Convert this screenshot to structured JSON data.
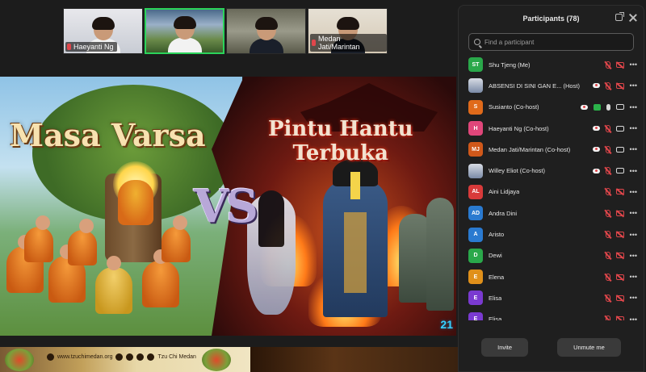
{
  "gallery": [
    {
      "name": "Haeyanti Ng",
      "muted": true
    },
    {
      "name": "",
      "muted": false
    },
    {
      "name": "",
      "muted": false
    },
    {
      "name": "Medan Jati/Marintan",
      "muted": true
    }
  ],
  "share": {
    "left_title": "Masa Varsa",
    "right_title_line1": "Pintu Hantu",
    "right_title_line2": "Terbuka",
    "vs_text": "VS",
    "corner_number": "21"
  },
  "banner": {
    "website": "www.tzuchimedan.org",
    "social_handle": "Tzu Chi Medan"
  },
  "participants_panel": {
    "title": "Participants (78)",
    "search_placeholder": "Find a participant",
    "invite_label": "Invite",
    "unmute_label": "Unmute me",
    "participants": [
      {
        "initials": "ST",
        "color": "#2aa84a",
        "name": "Shu Tjeng (Me)",
        "cloud": false,
        "share": false,
        "mic": "off",
        "cam": "off"
      },
      {
        "initials": "",
        "color": "",
        "photo": true,
        "name": "ABSENSI DI SINI GAN E... (Host)",
        "cloud": true,
        "share": false,
        "mic": "off",
        "cam": "off"
      },
      {
        "initials": "S",
        "color": "#e06a1a",
        "name": "Susianto (Co-host)",
        "cloud": true,
        "share": true,
        "mic": "on",
        "cam": "on"
      },
      {
        "initials": "H",
        "color": "#e0467a",
        "name": "Haeyanti Ng (Co-host)",
        "cloud": true,
        "share": false,
        "mic": "off",
        "cam": "on"
      },
      {
        "initials": "MJ",
        "color": "#d0581a",
        "name": "Medan Jati/Marintan (Co-host)",
        "cloud": true,
        "share": false,
        "mic": "off",
        "cam": "on"
      },
      {
        "initials": "",
        "color": "",
        "photo": true,
        "name": "Willey Eliot (Co-host)",
        "cloud": true,
        "share": false,
        "mic": "off",
        "cam": "on"
      },
      {
        "initials": "AL",
        "color": "#d83a3a",
        "name": "Aini Lidjaya",
        "cloud": false,
        "share": false,
        "mic": "off",
        "cam": "off"
      },
      {
        "initials": "AD",
        "color": "#2a7ad0",
        "name": "Andra Dini",
        "cloud": false,
        "share": false,
        "mic": "off",
        "cam": "off"
      },
      {
        "initials": "A",
        "color": "#2a7ad0",
        "name": "Aristo",
        "cloud": false,
        "share": false,
        "mic": "off",
        "cam": "off"
      },
      {
        "initials": "D",
        "color": "#2aa84a",
        "name": "Dewi",
        "cloud": false,
        "share": false,
        "mic": "off",
        "cam": "off"
      },
      {
        "initials": "E",
        "color": "#e0901a",
        "name": "Elena",
        "cloud": false,
        "share": false,
        "mic": "off",
        "cam": "off"
      },
      {
        "initials": "E",
        "color": "#7a3ad0",
        "name": "Elisa",
        "cloud": false,
        "share": false,
        "mic": "off",
        "cam": "off"
      },
      {
        "initials": "E",
        "color": "#7a3ad0",
        "name": "Elisa",
        "cloud": false,
        "share": false,
        "mic": "off",
        "cam": "off"
      }
    ]
  }
}
